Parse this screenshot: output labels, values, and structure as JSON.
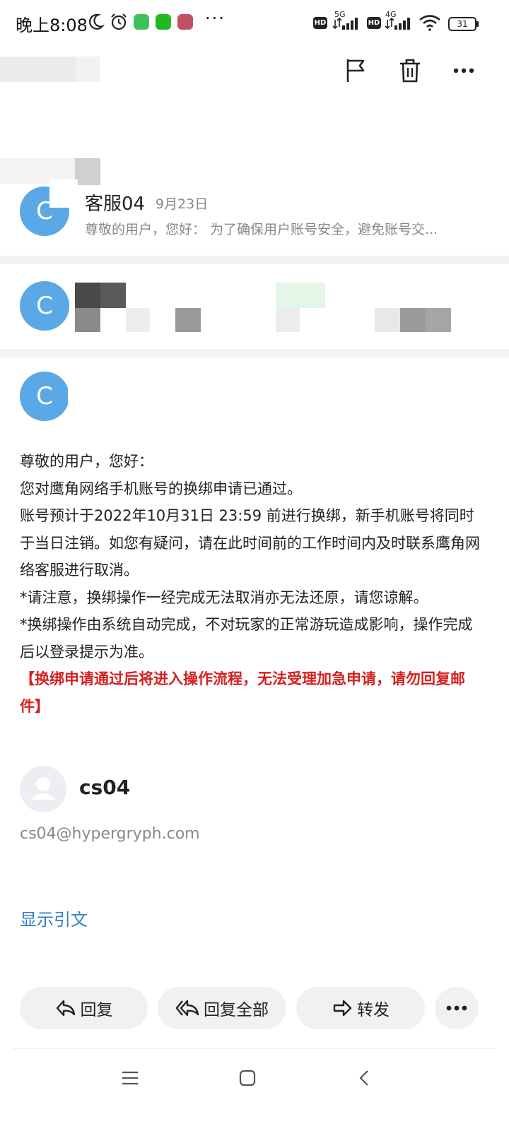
{
  "status_bar": {
    "time": "晚上8:08",
    "hd": "HD",
    "net1": "5G",
    "net2": "4G",
    "battery": "31",
    "more": "···"
  },
  "toolbar": {
    "icons": [
      "flag-icon",
      "trash-icon",
      "more-icon"
    ]
  },
  "thread": {
    "item1": {
      "avatar_letter": "C",
      "sender": "客服04",
      "date": "9月23日",
      "preview": "尊敬的用户，您好： 为了确保用户账号安全，避免账号交..."
    },
    "item2": {
      "avatar_letter": "C"
    },
    "item3": {
      "avatar_letter": "C"
    }
  },
  "mail": {
    "lines": [
      "尊敬的用户，您好：",
      "您对鹰角网络手机账号的换绑申请已通过。",
      "账号预计于2022年10月31日 23:59 前进行换绑，新手机账号将同时于当日注销。如您有疑问，请在此时间前的工作时间内及时联系鹰角网络客服进行取消。",
      "*请注意，换绑操作一经完成无法取消亦无法还原，请您谅解。",
      "*换绑操作由系统自动完成，不对玩家的正常游玩造成影响，操作完成后以登录提示为准。"
    ],
    "warning": "【换绑申请通过后将进入操作流程，无法受理加急申请，请勿回复邮件】"
  },
  "signature": {
    "name": "cs04",
    "email": "cs04@hypergryph.com"
  },
  "show_quote": "显示引文",
  "actions": {
    "reply": "回复",
    "reply_all": "回复全部",
    "forward": "转发"
  },
  "colors": {
    "avatar": "#5aa9e6",
    "warning": "#d81e1e",
    "link": "#2f7fc8",
    "button_bg": "#f0f1f3"
  }
}
